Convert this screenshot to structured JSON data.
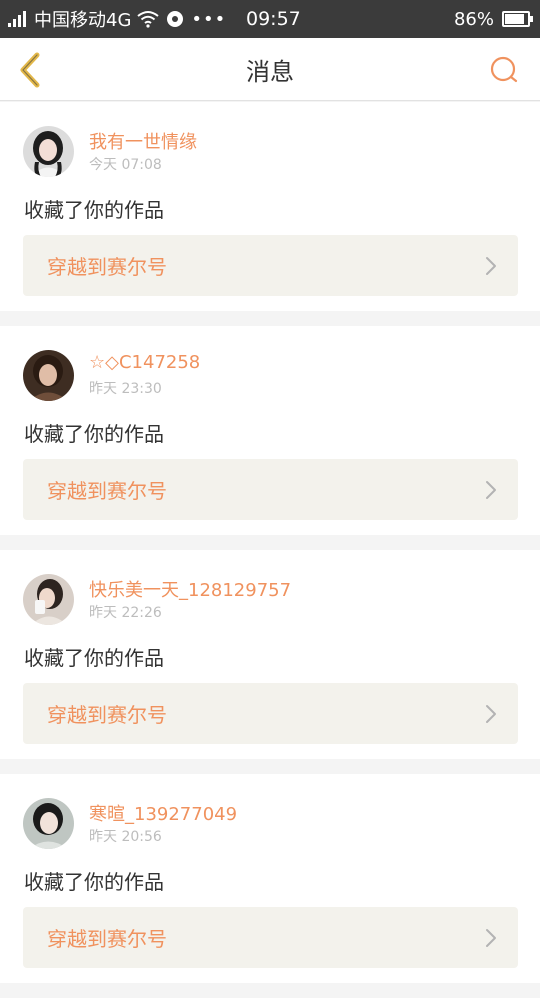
{
  "status_bar": {
    "carrier": "中国移动4G",
    "time": "09:57",
    "battery": "86%",
    "battery_level": 0.86
  },
  "header": {
    "title": "消息",
    "back_icon": "chevron-left-icon",
    "search_icon": "search-icon"
  },
  "colors": {
    "accent": "#f0925e",
    "back_arrow": "#e3b84a",
    "status_bar_bg": "#3b3b3b",
    "card_link_bg": "#f3f2ec"
  },
  "messages": [
    {
      "username": "我有一世情缘",
      "time": "今天 07:08",
      "action": "收藏了你的作品",
      "link_label": "穿越到赛尔号"
    },
    {
      "username": "☆◇C147258",
      "time": "昨天 23:30",
      "action": "收藏了你的作品",
      "link_label": "穿越到赛尔号"
    },
    {
      "username": "快乐美一天_128129757",
      "time": "昨天 22:26",
      "action": "收藏了你的作品",
      "link_label": "穿越到赛尔号"
    },
    {
      "username": "寒暄_139277049",
      "time": "昨天 20:56",
      "action": "收藏了你的作品",
      "link_label": "穿越到赛尔号"
    }
  ]
}
